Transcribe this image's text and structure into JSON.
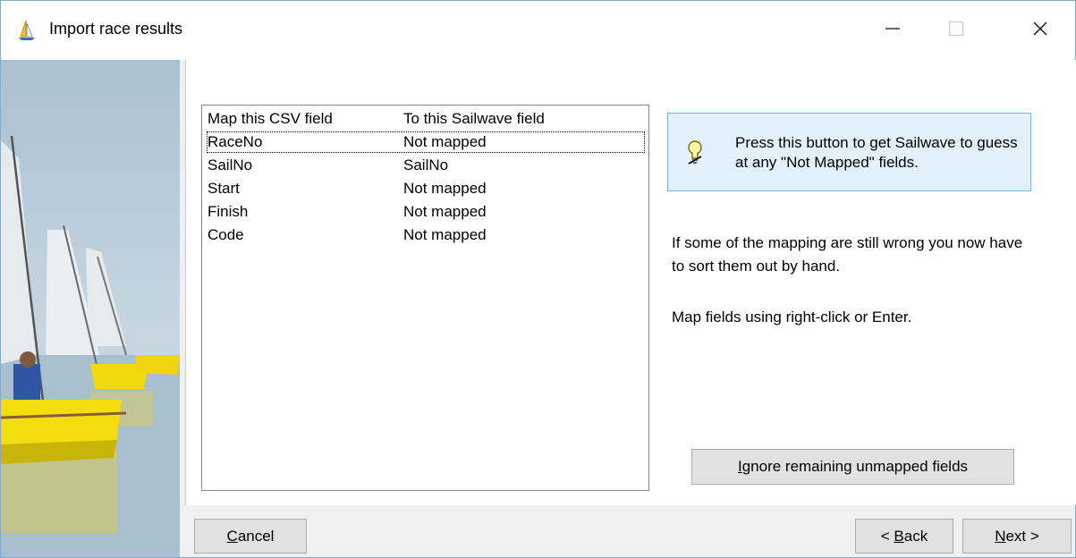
{
  "window": {
    "title": "Import race results",
    "icon": "sailboat-icon",
    "controls": [
      "minimize-icon",
      "maximize-icon",
      "close-icon"
    ]
  },
  "mapping_list": {
    "columns": [
      "Map this CSV field",
      "To this Sailwave field"
    ],
    "rows": [
      {
        "csv": "RaceNo",
        "sailwave": "Not mapped"
      },
      {
        "csv": "SailNo",
        "sailwave": "SailNo"
      },
      {
        "csv": "Start",
        "sailwave": "Not mapped"
      },
      {
        "csv": "Finish",
        "sailwave": "Not mapped"
      },
      {
        "csv": "Code",
        "sailwave": "Not mapped"
      }
    ]
  },
  "tip": {
    "icon": "lightbulb-icon",
    "text": "Press this button to get Sailwave to guess at any \"Not Mapped\" fields."
  },
  "info": {
    "line1": "If some of the mapping are still wrong you now have to sort them out by hand.",
    "line2": "Map fields using right-click or Enter."
  },
  "buttons": {
    "ignore_prefix": "",
    "ignore_mnemonic": "I",
    "ignore_rest": "gnore remaining unmapped fields",
    "cancel_mnemonic": "C",
    "cancel_rest": "ancel",
    "back_prefix": "< ",
    "back_mnemonic": "B",
    "back_rest": "ack",
    "next_mnemonic": "N",
    "next_rest": "ext >"
  },
  "colors": {
    "tip_background": "#e1f0fb",
    "tip_border": "#7eb4ea",
    "button_face": "#e1e1e1"
  }
}
